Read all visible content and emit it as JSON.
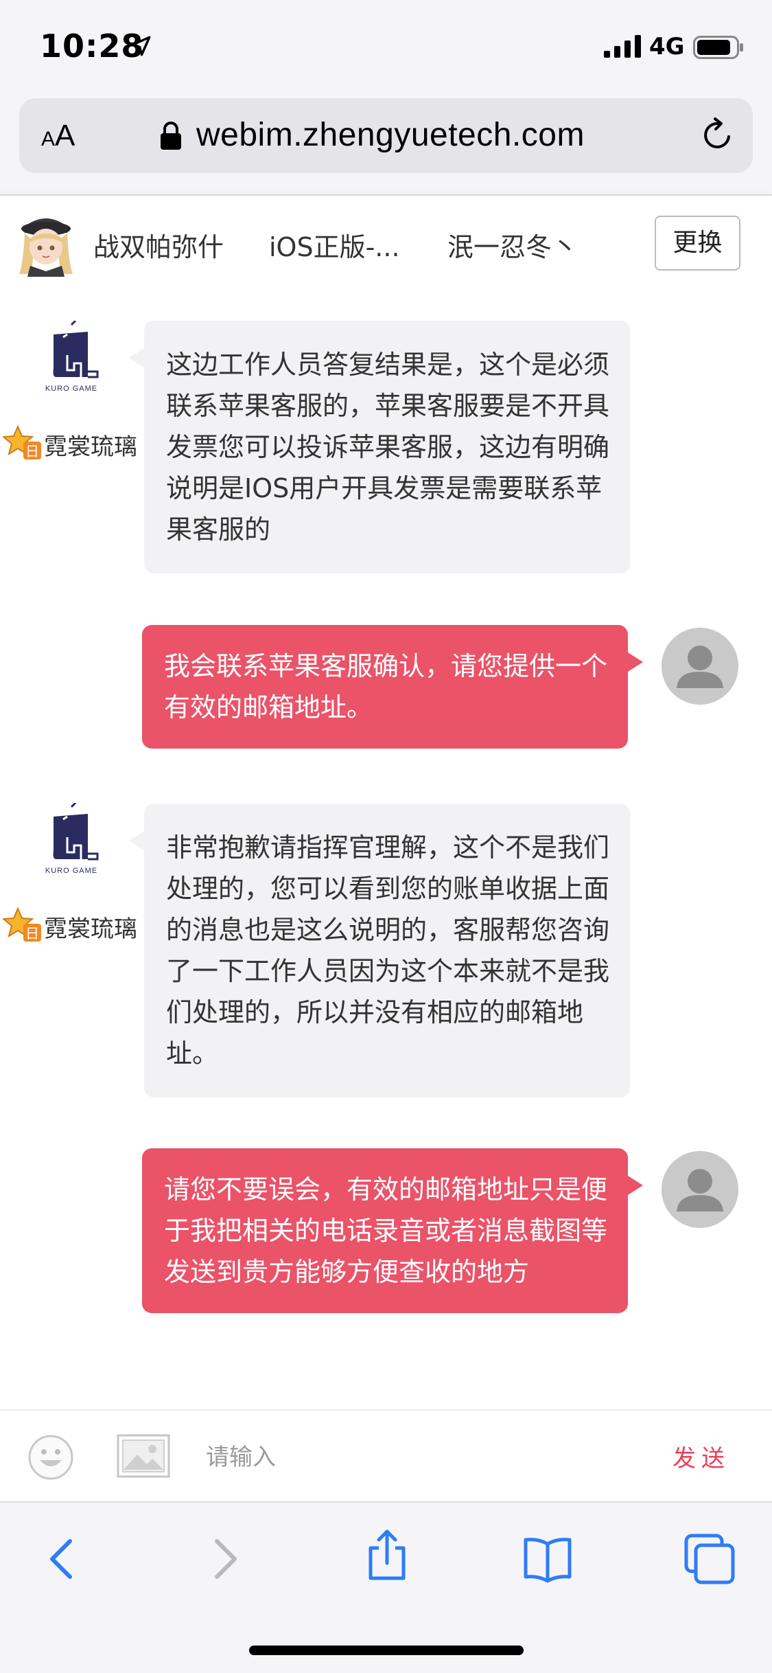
{
  "status_bar": {
    "time": "10:28",
    "network": "4G"
  },
  "browser": {
    "url": "webim.zhengyuetech.com",
    "aa_label": "AA"
  },
  "header": {
    "tabs": [
      "战双帕弥什",
      "iOS正版-...",
      "泯一忍冬丶"
    ],
    "change_button": "更换"
  },
  "messages": [
    {
      "from": "agent",
      "agent_name": "霓裳琉璃",
      "logo_text": "KURO GAME",
      "text": "这边工作人员答复结果是，这个是必须联系苹果客服的，苹果客服要是不开具发票您可以投诉苹果客服，这边有明确说明是IOS用户开具发票是需要联系苹果客服的"
    },
    {
      "from": "user",
      "text": "我会联系苹果客服确认，请您提供一个有效的邮箱地址。"
    },
    {
      "from": "agent",
      "agent_name": "霓裳琉璃",
      "logo_text": "KURO GAME",
      "text": "非常抱歉请指挥官理解，这个不是我们处理的，您可以看到您的账单收据上面的消息也是这么说明的，客服帮您咨询了一下工作人员因为这个本来就不是我们处理的，所以并没有相应的邮箱地址。"
    },
    {
      "from": "user",
      "text": "请您不要误会，有效的邮箱地址只是便于我把相关的电话录音或者消息截图等发送到贵方能够方便查收的地方"
    }
  ],
  "input_bar": {
    "placeholder": "请输入",
    "send_label": "发送"
  },
  "colors": {
    "user_bubble": "#ea5368",
    "agent_bubble": "#f2f2f4",
    "send": "#e8425a",
    "ios_blue": "#2f7cf6"
  },
  "toolbar": {
    "icons": [
      "back-icon",
      "forward-icon",
      "share-icon",
      "bookmarks-icon",
      "tabs-icon"
    ]
  }
}
